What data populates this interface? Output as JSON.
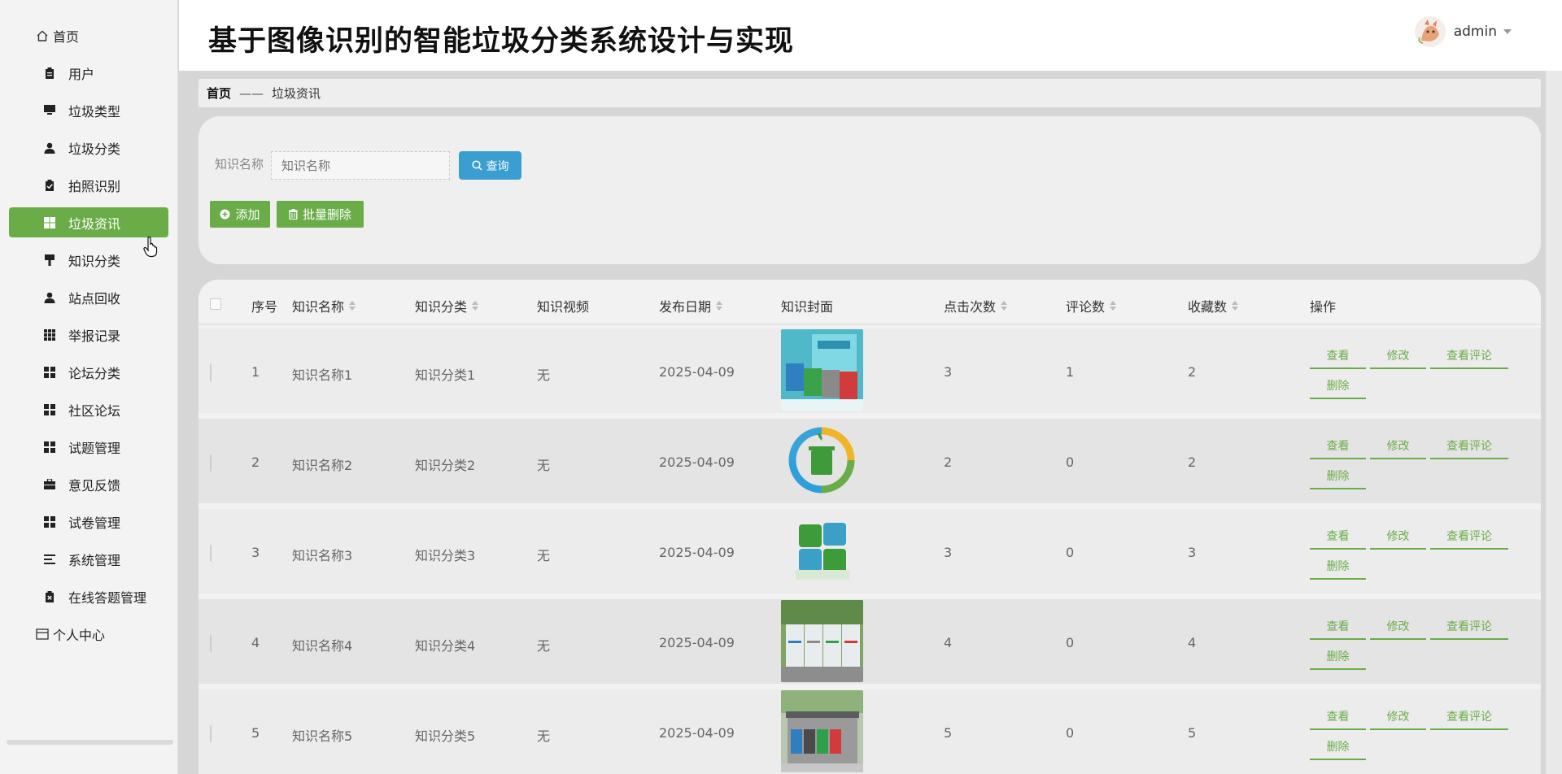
{
  "app": {
    "title": "基于图像识别的智能垃圾分类系统设计与实现"
  },
  "user": {
    "name": "admin"
  },
  "sidebar": {
    "items": [
      {
        "label": "首页",
        "icon": "home-icon"
      },
      {
        "label": "用户",
        "icon": "clipboard-icon"
      },
      {
        "label": "垃圾类型",
        "icon": "monitor-icon"
      },
      {
        "label": "垃圾分类",
        "icon": "person-icon"
      },
      {
        "label": "拍照识别",
        "icon": "clipboard-check-icon"
      },
      {
        "label": "垃圾资讯",
        "icon": "grid-icon",
        "active": true
      },
      {
        "label": "知识分类",
        "icon": "brush-icon"
      },
      {
        "label": "站点回收",
        "icon": "person-icon"
      },
      {
        "label": "举报记录",
        "icon": "apps-icon"
      },
      {
        "label": "论坛分类",
        "icon": "grid-icon"
      },
      {
        "label": "社区论坛",
        "icon": "grid-icon"
      },
      {
        "label": "试题管理",
        "icon": "grid-icon"
      },
      {
        "label": "意见反馈",
        "icon": "briefcase-icon"
      },
      {
        "label": "试卷管理",
        "icon": "grid-icon"
      },
      {
        "label": "系统管理",
        "icon": "list-icon"
      },
      {
        "label": "在线答题管理",
        "icon": "clipboard-x-icon"
      },
      {
        "label": "个人中心",
        "icon": "card-icon"
      }
    ]
  },
  "breadcrumb": {
    "home": "首页",
    "separator": "——",
    "current": "垃圾资讯"
  },
  "search": {
    "label": "知识名称",
    "placeholder": "知识名称",
    "button": "查询",
    "add_button": "添加",
    "batch_delete_button": "批量删除"
  },
  "table": {
    "headers": [
      "序号",
      "知识名称",
      "知识分类",
      "知识视频",
      "发布日期",
      "知识封面",
      "点击次数",
      "评论数",
      "收藏数",
      "操作"
    ],
    "actions": {
      "view": "查看",
      "edit": "修改",
      "comments": "查看评论",
      "delete": "删除"
    },
    "rows": [
      {
        "no": "1",
        "name": "知识名称1",
        "category": "知识分类1",
        "video": "无",
        "date": "2025-04-09",
        "clicks": "3",
        "comments": "1",
        "favorites": "2"
      },
      {
        "no": "2",
        "name": "知识名称2",
        "category": "知识分类2",
        "video": "无",
        "date": "2025-04-09",
        "clicks": "2",
        "comments": "0",
        "favorites": "2"
      },
      {
        "no": "3",
        "name": "知识名称3",
        "category": "知识分类3",
        "video": "无",
        "date": "2025-04-09",
        "clicks": "3",
        "comments": "0",
        "favorites": "3"
      },
      {
        "no": "4",
        "name": "知识名称4",
        "category": "知识分类4",
        "video": "无",
        "date": "2025-04-09",
        "clicks": "4",
        "comments": "0",
        "favorites": "4"
      },
      {
        "no": "5",
        "name": "知识名称5",
        "category": "知识分类5",
        "video": "无",
        "date": "2025-04-09",
        "clicks": "5",
        "comments": "0",
        "favorites": "5"
      }
    ]
  },
  "colors": {
    "accent": "#6aad48",
    "search": "#3a9fd0"
  }
}
